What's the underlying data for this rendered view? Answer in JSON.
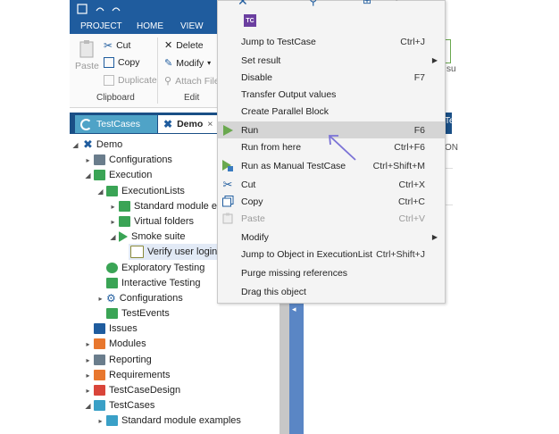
{
  "ribbon": {
    "tabs": [
      "PROJECT",
      "HOME",
      "VIEW"
    ],
    "buttons": {
      "paste": "Paste",
      "cut": "Cut",
      "copy": "Copy",
      "duplicate": "Duplicate",
      "delete": "Delete",
      "modify": "Modify",
      "attach": "Attach File"
    },
    "groups": [
      "Clipboard",
      "Edit"
    ]
  },
  "doc_tabs": {
    "testcases": "TestCases",
    "demo": "Demo",
    "demo_close": "×"
  },
  "tree": {
    "demo": "Demo",
    "configurations": "Configurations",
    "execution": "Execution",
    "executionlists": "ExecutionLists",
    "standard_module": "Standard module e",
    "virtual_folders": "Virtual folders",
    "smoke_suite": "Smoke suite",
    "verify_login": "Verify user login",
    "exploratory": "Exploratory Testing",
    "interactive": "Interactive Testing",
    "configurations2": "Configurations",
    "testevents": "TestEvents",
    "issues": "Issues",
    "modules": "Modules",
    "reporting": "Reporting",
    "requirements": "Requirements",
    "testcasedesign": "TestCaseDesign",
    "testcases": "TestCases",
    "standard_module_examples": "Standard module examples"
  },
  "right_fragments": {
    "edge_text": "ON",
    "edge_text2": "su",
    "edge_tab": "Te"
  },
  "menu": {
    "top_icon_label": "TC",
    "items": [
      {
        "label": "Jump to TestCase",
        "shortcut": "Ctrl+J"
      },
      {
        "label": "Set result",
        "shortcut": ""
      },
      {
        "label": "Disable",
        "shortcut": "F7"
      },
      {
        "label": "Transfer Output values",
        "shortcut": ""
      },
      {
        "label": "Create Parallel Block",
        "shortcut": ""
      },
      {
        "label": "Run",
        "shortcut": "F6"
      },
      {
        "label": "Run from here",
        "shortcut": "Ctrl+F6"
      },
      {
        "label": "Run as Manual TestCase",
        "shortcut": "Ctrl+Shift+M"
      },
      {
        "label": "Cut",
        "shortcut": "Ctrl+X"
      },
      {
        "label": "Copy",
        "shortcut": "Ctrl+C"
      },
      {
        "label": "Paste",
        "shortcut": "Ctrl+V"
      },
      {
        "label": "Modify",
        "shortcut": ""
      },
      {
        "label": "Jump to Object in ExecutionList",
        "shortcut": "Ctrl+Shift+J"
      },
      {
        "label": "Purge missing references",
        "shortcut": ""
      },
      {
        "label": "Drag this object",
        "shortcut": ""
      }
    ]
  },
  "colors": {
    "ribbon_blue": "#1f5c9e",
    "menu_highlight": "#d5d5d5",
    "run_green": "#6aa84f",
    "annotation_arrow": "#7b73d6"
  }
}
